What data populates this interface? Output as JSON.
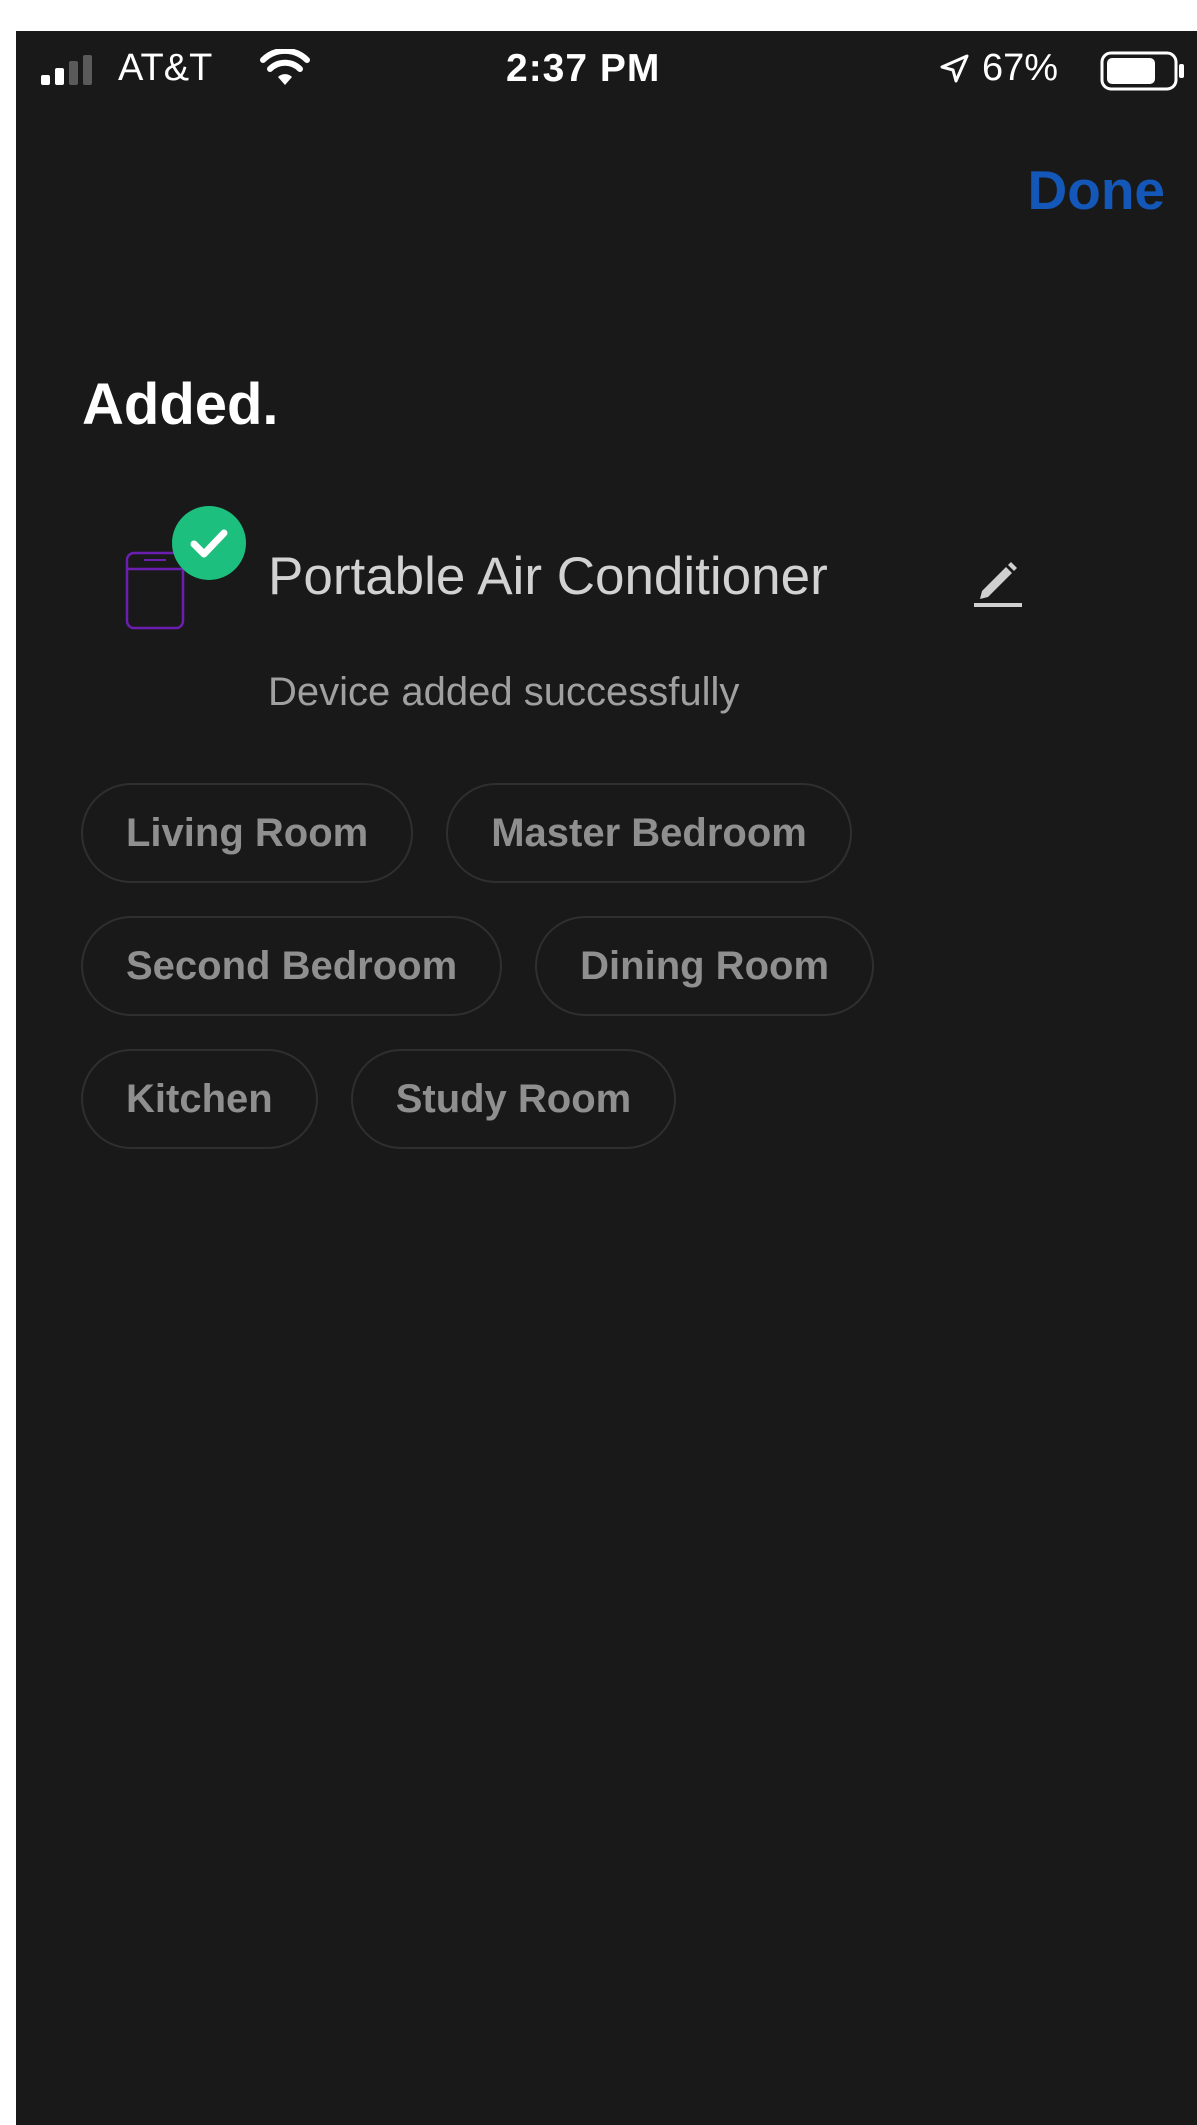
{
  "status_bar": {
    "carrier": "AT&T",
    "time": "2:37 PM",
    "battery_percent": "67%",
    "icons": [
      "signal-icon",
      "wifi-icon",
      "location-arrow-icon",
      "battery-icon"
    ]
  },
  "nav": {
    "done_label": "Done"
  },
  "page": {
    "title": "Added."
  },
  "device": {
    "name": "Portable Air Conditioner",
    "status": "Device added successfully",
    "icons": [
      "air-conditioner-icon",
      "success-check-icon",
      "edit-pencil-icon"
    ]
  },
  "rooms": {
    "rows": [
      [
        "Living Room",
        "Master Bedroom"
      ],
      [
        "Second Bedroom",
        "Dining Room"
      ],
      [
        "Kitchen",
        "Study Room"
      ]
    ]
  },
  "colors": {
    "background": "#191919",
    "accent": "#1358b8",
    "success": "#1dbf7e",
    "device_icon": "#6b1fb0",
    "chip_border": "#2f2f2f",
    "chip_text": "#8f8f8f"
  }
}
